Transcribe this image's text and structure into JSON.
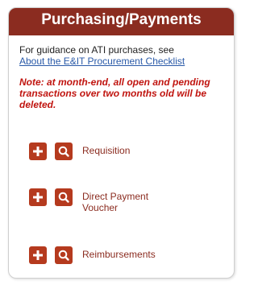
{
  "panel": {
    "title": "Purchasing/Payments",
    "guidance_text": "For guidance on ATI purchases, see",
    "guidance_link": "About the E&IT Procurement Checklist",
    "note": "Note: at month-end, all open and pending transactions over two months old will be deleted.",
    "actions": [
      {
        "label": "Requisition"
      },
      {
        "label": "Direct Payment Voucher"
      },
      {
        "label": "Reimbursements"
      }
    ]
  },
  "colors": {
    "header_bg": "#8b2c20",
    "button_bg": "#b53a1e",
    "note_text": "#c0140f",
    "link": "#2a5aa8"
  },
  "icons": [
    "plus-icon",
    "search-icon"
  ]
}
